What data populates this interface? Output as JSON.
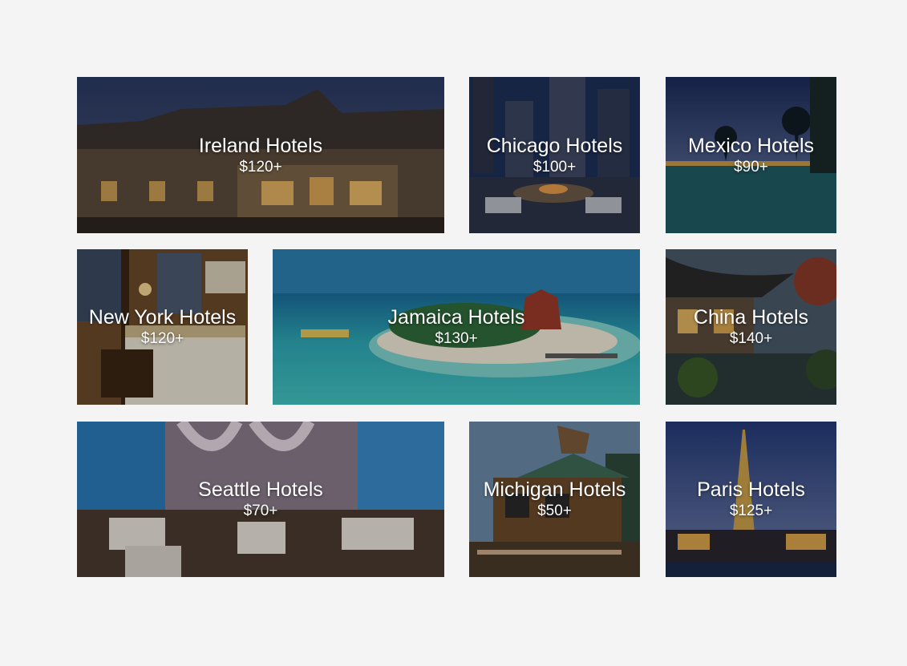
{
  "tiles": [
    {
      "name": "Ireland Hotels",
      "price": "$120+"
    },
    {
      "name": "Chicago Hotels",
      "price": "$100+"
    },
    {
      "name": "Mexico Hotels",
      "price": "$90+"
    },
    {
      "name": "New York Hotels",
      "price": "$120+"
    },
    {
      "name": "Jamaica Hotels",
      "price": "$130+"
    },
    {
      "name": "China Hotels",
      "price": "$140+"
    },
    {
      "name": "Seattle Hotels",
      "price": "$70+"
    },
    {
      "name": "Michigan Hotels",
      "price": "$50+"
    },
    {
      "name": "Paris Hotels",
      "price": "$125+"
    }
  ]
}
